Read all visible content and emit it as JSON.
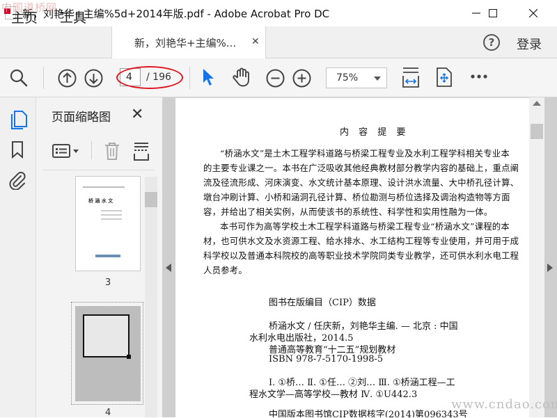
{
  "window": {
    "title": "新，刘艳华+主编%5d+2014年版.pdf - Adobe Acrobat Pro DC",
    "watermark_top": "中国道桥网"
  },
  "menu": {
    "home": "主页",
    "tools": "工具",
    "doc_tab": "新，刘艳华+主编%...",
    "login": "登录",
    "help_glyph": "?"
  },
  "toolbar": {
    "current_page": "4",
    "page_total": "/ 196",
    "zoom": "75%"
  },
  "panel": {
    "title": "页面缩略图",
    "thumbs": [
      {
        "label": "3",
        "cover_title": "桥 涵 水 文"
      },
      {
        "label": "4"
      }
    ]
  },
  "page": {
    "heading": "内 容 提 要",
    "lines": [
      "“桥涵水文”是土木工程学科道路与桥梁工程专业及水利工程学科相关专业本",
      "的主要专业课之一。本书在广泛吸收其他经典教材部分教学内容的基础上，重点阐",
      "流及径流形成、河床演变、水文统计基本原理、设计洪水流量、大中桥孔径计算、",
      "墩台冲刷计算、小桥和涵洞孔径计算、桥位勘测与桥位选择及调治构造物等方面",
      "容，并给出了相关实例，从而使该书的系统性、科学性和实用性融为一体。",
      "本书可作为高等学校土木工程学科道路与桥梁工程专业“桥涵水文”课程的本",
      "材，也可供水文及水资源工程、给水排水、水工结构工程等专业使用，并可用于成",
      "科学校以及普通本科院校的高等职业技术学院同类专业教学，还可供水利水电工程",
      "人员参考。"
    ],
    "cip_title": "图书在版编目（CIP）数据",
    "cip_lines": [
      "桥涵水文 / 任庆新，刘艳华主编. — 北京 : 中国",
      "水利水电出版社，2014.5",
      "普通高等教育“十二五”规划教材",
      "ISBN 978-7-5170-1998-5",
      "Ⅰ. ①桥… Ⅱ. ①任… ②刘… Ⅲ. ①桥涵工程—工",
      "程水文学—高等学校—教材 Ⅳ. ①U442.3",
      "中国版本图书馆CIP数据核字(2014)第096343号"
    ]
  },
  "watermark_bottom": "www.cndao.com",
  "colors": {
    "accent_blue": "#1473e6",
    "annotation_red": "#e0141e"
  },
  "icons": [
    "search-icon",
    "page-up-icon",
    "page-down-icon",
    "select-arrow-icon",
    "hand-tool-icon",
    "zoom-out-icon",
    "zoom-in-icon",
    "fit-width-icon",
    "fit-page-icon",
    "more-icon",
    "thumbnails-icon",
    "bookmark-icon",
    "attachment-icon",
    "options-menu-icon",
    "trash-icon",
    "insert-page-icon"
  ]
}
